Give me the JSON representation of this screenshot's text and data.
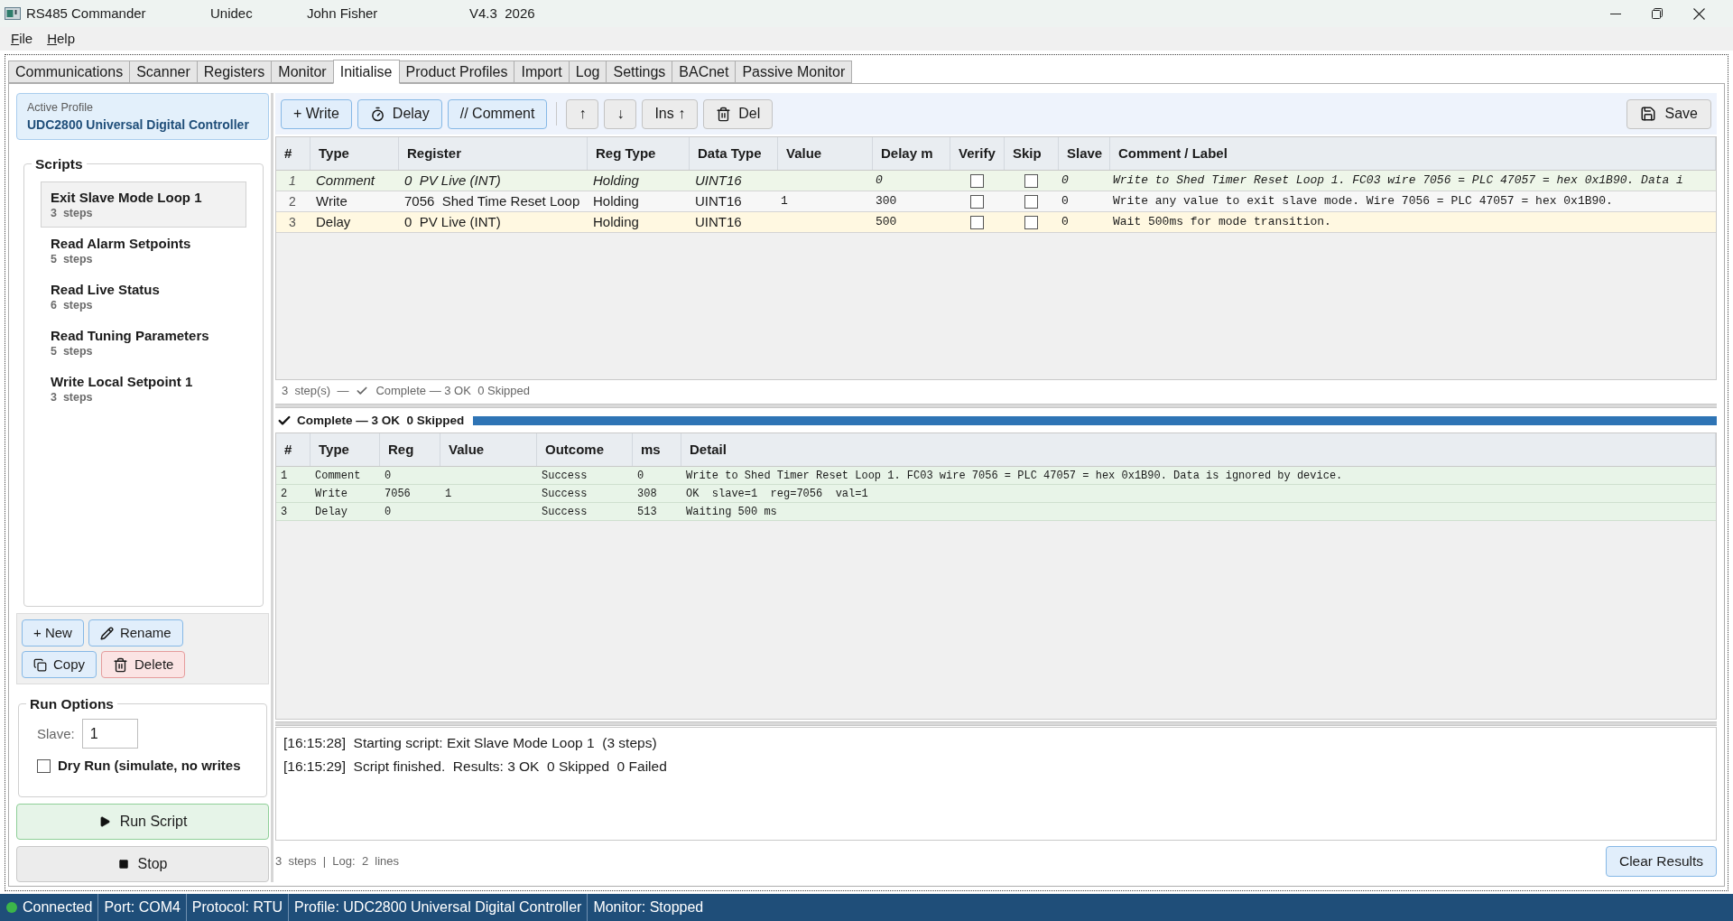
{
  "window": {
    "title": "RS485 Commander",
    "company": "Unidec",
    "user": "John Fisher",
    "version": "V4.3  2026"
  },
  "menu": [
    "File",
    "Help"
  ],
  "tabs": [
    {
      "label": "Communications",
      "selected": false
    },
    {
      "label": "Scanner",
      "selected": false
    },
    {
      "label": "Registers",
      "selected": false
    },
    {
      "label": "Monitor",
      "selected": false
    },
    {
      "label": "Initialise",
      "selected": true
    },
    {
      "label": "Product Profiles",
      "selected": false
    },
    {
      "label": "Import",
      "selected": false
    },
    {
      "label": "Log",
      "selected": false
    },
    {
      "label": "Settings",
      "selected": false
    },
    {
      "label": "BACnet",
      "selected": false
    },
    {
      "label": "Passive Monitor",
      "selected": false
    }
  ],
  "active_profile": {
    "label": "Active Profile",
    "name": "UDC2800 Universal Digital Controller"
  },
  "scripts": {
    "title": "Scripts",
    "items": [
      {
        "name": "Exit Slave Mode Loop 1",
        "steps": "3  steps",
        "selected": true
      },
      {
        "name": "Read Alarm Setpoints",
        "steps": "5  steps",
        "selected": false
      },
      {
        "name": "Read Live Status",
        "steps": "6  steps",
        "selected": false
      },
      {
        "name": "Read Tuning Parameters",
        "steps": "5  steps",
        "selected": false
      },
      {
        "name": "Write Local Setpoint 1",
        "steps": "3  steps",
        "selected": false
      }
    ]
  },
  "script_actions": [
    {
      "kind": "new",
      "label": "+ New"
    },
    {
      "kind": "rename",
      "label": "Rename"
    },
    {
      "kind": "copy",
      "label": "Copy"
    },
    {
      "kind": "delete",
      "label": "Delete"
    }
  ],
  "run_options": {
    "title": "Run Options",
    "slave_label": "Slave:",
    "slave": "1",
    "dry_run": {
      "label": "Dry Run (simulate, no writes",
      "checked": false
    }
  },
  "run_buttons": [
    {
      "kind": "run",
      "label": "Run Script"
    },
    {
      "kind": "stop",
      "label": "Stop"
    }
  ],
  "toolbar": {
    "groups": [
      [
        {
          "kind": "write",
          "label": "+ Write"
        },
        {
          "kind": "delay",
          "label": "Delay"
        },
        {
          "kind": "comment",
          "label": "// Comment"
        }
      ],
      [
        {
          "kind": "up",
          "label": "↑"
        },
        {
          "kind": "down",
          "label": "↓"
        },
        {
          "kind": "insert",
          "label": "Ins ↑"
        },
        {
          "kind": "delete",
          "label": "Del"
        }
      ]
    ],
    "save": "Save"
  },
  "steps_table": {
    "columns": [
      "#",
      "Type",
      "Register",
      "Reg Type",
      "Data Type",
      "Value",
      "Delay m",
      "Verify",
      "Skip",
      "Slave",
      "Comment / Label"
    ],
    "rows": [
      {
        "kind": "comment",
        "number": "1",
        "type": "Comment",
        "register": "0  PV Live (INT)",
        "reg_type": "Holding",
        "data_type": "UINT16",
        "delay_ms": "0",
        "verify": false,
        "skip": false,
        "slave": "0",
        "comment": "Write to Shed Timer Reset Loop 1. FC03 wire 7056 = PLC 47057 = hex 0x1B90. Data i"
      },
      {
        "kind": "write",
        "number": "2",
        "type": "Write",
        "register": "7056  Shed Time Reset Loop",
        "reg_type": "Holding",
        "data_type": "UINT16",
        "value": "1",
        "delay_ms": "300",
        "verify": false,
        "skip": false,
        "slave": "0",
        "comment": "Write any value to exit slave mode. Wire 7056 = PLC 47057 = hex 0x1B90."
      },
      {
        "kind": "delay",
        "number": "3",
        "type": "Delay",
        "register": "0  PV Live (INT)",
        "reg_type": "Holding",
        "data_type": "UINT16",
        "delay_ms": "500",
        "verify": false,
        "skip": false,
        "slave": "0",
        "comment": "Wait 500ms for mode transition."
      }
    ]
  },
  "steps_status": {
    "count": "3  step(s)  —",
    "result": "Complete — 3 OK  0 Skipped"
  },
  "progress": {
    "label": "Complete — 3 OK  0 Skipped",
    "level": 1
  },
  "results_table": {
    "columns": [
      "#",
      "Type",
      "Reg",
      "Value",
      "Outcome",
      "ms",
      "Detail"
    ],
    "rows": [
      {
        "kind": "success",
        "number": "1",
        "type": "Comment",
        "register": "0",
        "outcome": "Success",
        "ms": "0",
        "detail": "Write to Shed Timer Reset Loop 1. FC03 wire 7056 = PLC 47057 = hex 0x1B90. Data is ignored by device."
      },
      {
        "kind": "success",
        "number": "2",
        "type": "Write",
        "register": "7056",
        "value": "1",
        "outcome": "Success",
        "ms": "308",
        "detail": "OK  slave=1  reg=7056  val=1"
      },
      {
        "kind": "success",
        "number": "3",
        "type": "Delay",
        "register": "0",
        "outcome": "Success",
        "ms": "513",
        "detail": "Waiting 500 ms"
      }
    ]
  },
  "log": [
    "[16:15:28]  Starting script: Exit Slave Mode Loop 1  (3 steps)",
    "[16:15:29]  Script finished.  Results: 3 OK  0 Skipped  0 Failed"
  ],
  "footer": {
    "summary": "3  steps  |  Log:  2  lines",
    "button": "Clear Results"
  },
  "status_bar": {
    "connected": true,
    "items": [
      "Connected",
      "Port: COM4",
      "Protocol: RTU",
      "Profile: UDC2800 Universal Digital Controller",
      "Monitor: Stopped"
    ]
  }
}
